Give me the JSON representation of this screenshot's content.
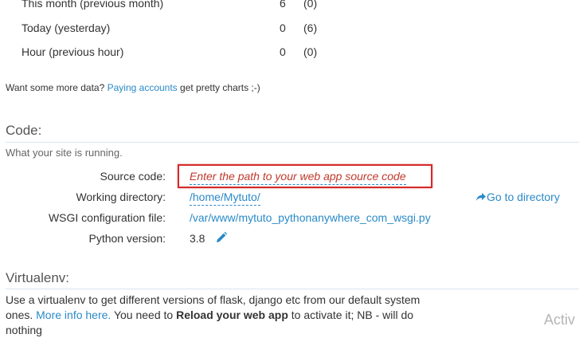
{
  "stats": {
    "rows": [
      {
        "label": "This month (previous month)",
        "value": "6",
        "prev": "(0)"
      },
      {
        "label": "Today (yesterday)",
        "value": "0",
        "prev": "(6)"
      },
      {
        "label": "Hour (previous hour)",
        "value": "0",
        "prev": "(0)"
      }
    ],
    "more_prefix": "Want some more data?",
    "more_link": "Paying accounts",
    "more_suffix": "get pretty charts ;-)"
  },
  "code": {
    "title": "Code:",
    "subtitle": "What your site is running.",
    "source_label": "Source code:",
    "source_placeholder": "Enter the path to your web app source code",
    "workdir_label": "Working directory:",
    "workdir_value": "/home/Mytuto/",
    "goto_dir": "Go to directory",
    "wsgi_label": "WSGI configuration file:",
    "wsgi_value": "/var/www/mytuto_pythonanywhere_com_wsgi.py",
    "python_label": "Python version:",
    "python_value": "3.8",
    "highlight_color": "#d42a2a"
  },
  "virtualenv": {
    "title": "Virtualenv:",
    "line1": "Use a virtualenv to get different versions of flask, django etc from our default system",
    "line2_a": "ones.",
    "line2_link": "More info here.",
    "line2_b": "You need to",
    "line2_bold": "Reload your web app",
    "line2_c": "to activate it; NB - will do nothing"
  },
  "watermark": "Activ"
}
